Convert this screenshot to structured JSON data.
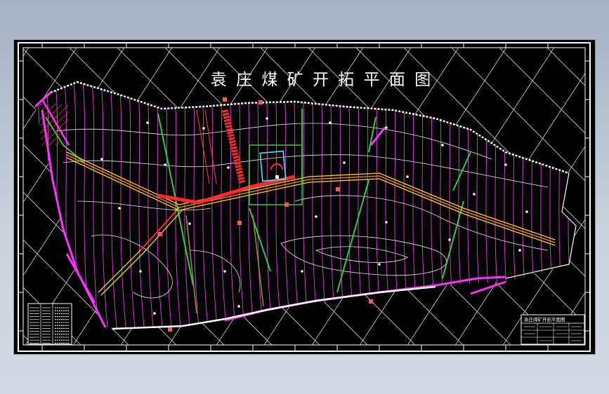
{
  "drawing": {
    "title": "袁 庄 煤 矿 开 拓 平 面 图"
  },
  "title_block": {
    "text": "袁庄煤矿开拓平面图"
  },
  "colors": {
    "background": "#000000",
    "frame": "#ffffff",
    "boundary": "#ff33ff",
    "grid": "#dcdcdc",
    "contour": "#ff66ff",
    "roadway_main": "#ff2a2a",
    "roadway_belt": "#ffd21f",
    "fault": "#2ecc40",
    "shaft": "#33ffff"
  }
}
